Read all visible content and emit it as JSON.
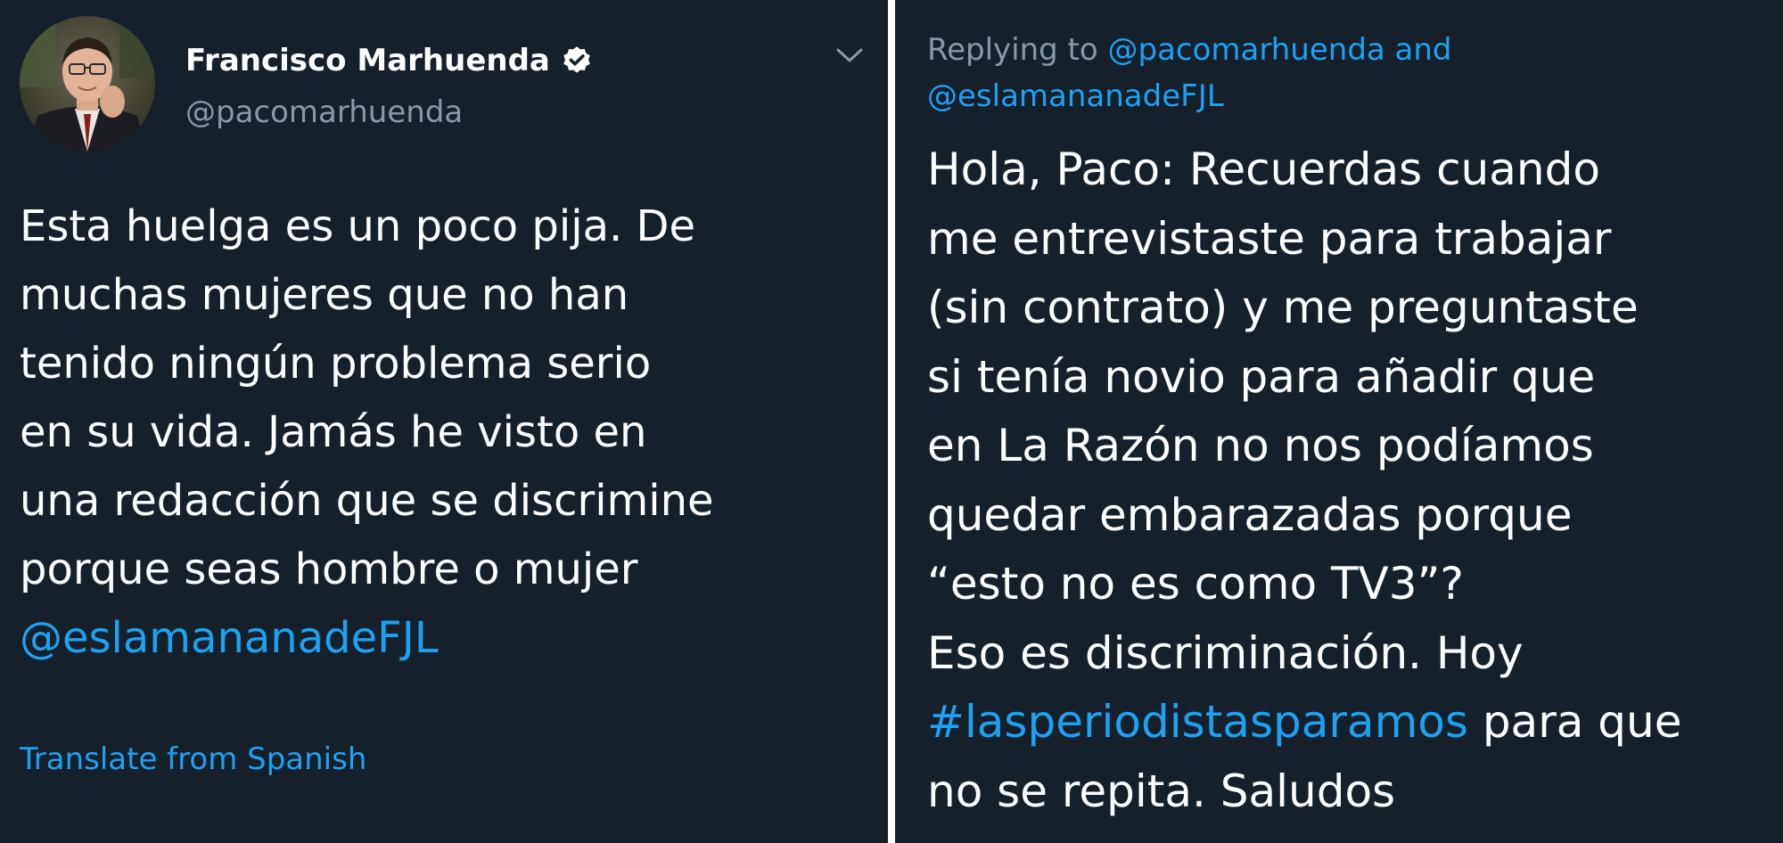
{
  "colors": {
    "background": "#15202b",
    "text": "#ffffff",
    "muted": "#8899a6",
    "link": "#1da1f2",
    "divider": "#ffffff"
  },
  "left_tweet": {
    "author": {
      "display_name": "Francisco Marhuenda",
      "handle": "@pacomarhuenda",
      "verified_icon": "verified-badge-icon",
      "avatar": "profile-photo"
    },
    "menu_icon": "chevron-down-icon",
    "text_lines": [
      "Esta huelga es un poco pija. De",
      "muchas mujeres que no han",
      "tenido ningún problema serio",
      "en su vida. Jamás he visto en",
      "una redacción que se discrimine",
      "porque seas hombre o mujer"
    ],
    "mention": "@eslamananadeFJL",
    "translate_label": "Translate from Spanish"
  },
  "right_tweet": {
    "replying_prefix": "Replying to ",
    "replying_user1": "@pacomarhuenda",
    "replying_and": " and",
    "replying_user2": "@eslamananadeFJL",
    "text_lines": [
      "Hola, Paco: Recuerdas cuando",
      "me entrevistaste para trabajar",
      "(sin contrato) y me preguntaste",
      "si tenía novio para añadir que",
      "en La Razón no nos podíamos",
      "quedar embarazadas porque",
      "“esto no es como TV3”?",
      "Eso es discriminación. Hoy"
    ],
    "hashtag": "#lasperiodistasparamos",
    "hashtag_suffix": " para que",
    "last_line": "no se repita. Saludos"
  }
}
